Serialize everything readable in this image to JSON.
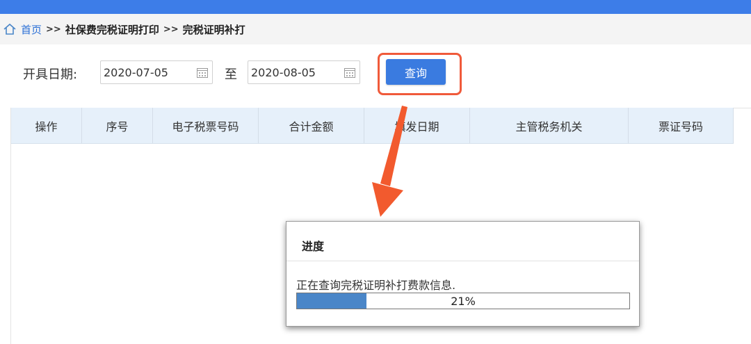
{
  "breadcrumb": {
    "home": "首页",
    "separator": ">>",
    "items": [
      "社保费完税证明打印",
      "完税证明补打"
    ]
  },
  "filter": {
    "label": "开具日期:",
    "start_date": "2020-07-05",
    "to_label": "至",
    "end_date": "2020-08-05",
    "query_label": "查询"
  },
  "table": {
    "columns": [
      "操作",
      "序号",
      "电子税票号码",
      "合计金额",
      "填发日期",
      "主管税务机关",
      "票证号码"
    ]
  },
  "dialog": {
    "title": "进度",
    "message": "正在查询完税证明补打费款信息.",
    "progress_label": "21%",
    "progress_value": 0.21
  },
  "colors": {
    "topbar": "#3d7de8",
    "accent": "#3a7be0",
    "annotation": "#f05a3a",
    "progress_fill": "#4a86c8"
  },
  "icons": {
    "home": "home-icon",
    "calendar": "calendar-icon",
    "annotation_arrow": "arrow-icon"
  }
}
